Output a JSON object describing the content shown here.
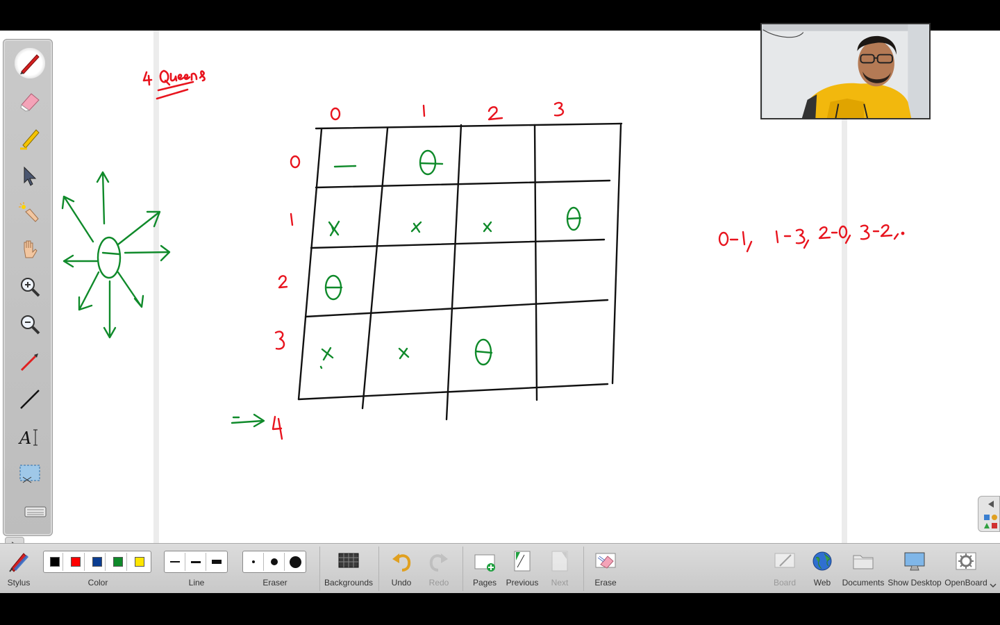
{
  "board": {
    "heading_text": "4 Queens",
    "col_labels": [
      "0",
      "1",
      "2",
      "3"
    ],
    "row_labels": [
      "0",
      "1",
      "2",
      "3"
    ],
    "cells": [
      [
        "—",
        "Q",
        "",
        ""
      ],
      [
        "x",
        "x",
        "x",
        "Q"
      ],
      [
        "Q",
        "",
        "",
        ""
      ],
      [
        "x",
        "x",
        "Q",
        ""
      ]
    ],
    "arrow_note": "4",
    "solution_text": "0-1,  1-3,  2-0,  3-2,.",
    "ink_colors": {
      "red": "#e8141e",
      "green": "#0f8a2a",
      "black": "#111111"
    }
  },
  "palette": {
    "tools": [
      "pen-tool",
      "eraser-tool",
      "marker-tool",
      "selector-tool",
      "laser-pointer-tool",
      "hand-tool",
      "zoom-in-tool",
      "zoom-out-tool",
      "pointer-tool",
      "line-tool",
      "text-tool",
      "capture-tool",
      "keyboard-tool"
    ],
    "active": "pen-tool"
  },
  "toolbar": {
    "stylus": "Stylus",
    "color": "Color",
    "colors": [
      "#000000",
      "#ff0000",
      "#0b3d91",
      "#0f8a2a",
      "#ffe600"
    ],
    "line": "Line",
    "eraser": "Eraser",
    "backgrounds": "Backgrounds",
    "undo": "Undo",
    "redo": "Redo",
    "pages": "Pages",
    "previous": "Previous",
    "next": "Next",
    "erase": "Erase",
    "board": "Board",
    "web": "Web",
    "documents": "Documents",
    "show_desktop": "Show Desktop",
    "openboard": "OpenBoard"
  }
}
